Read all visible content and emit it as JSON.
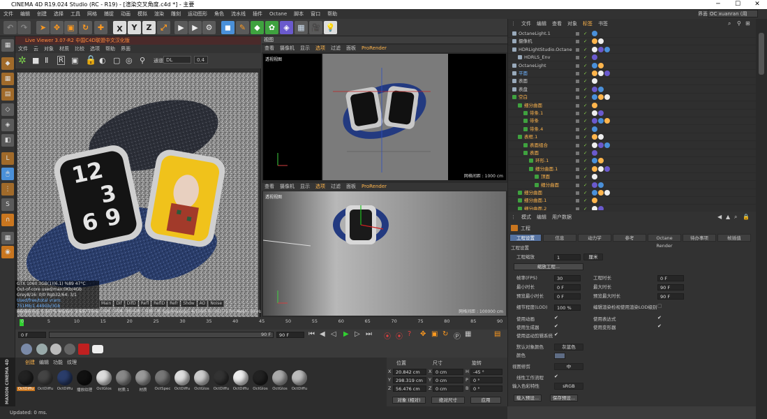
{
  "window": {
    "title": "CINEMA 4D R19.024 Studio (RC - R19) - [渲染交叉角度.c4d *] - 主要",
    "interface_label": "界面:",
    "interface_value": "OC xuanran (用户)"
  },
  "menu": [
    "文件",
    "编辑",
    "创建",
    "选择",
    "工具",
    "网格",
    "捕捉",
    "动画",
    "模拟",
    "渲染",
    "雕刻",
    "运动图形",
    "角色",
    "流水线",
    "插件",
    "Octane",
    "脚本",
    "窗口",
    "帮助"
  ],
  "toolbar": {
    "labels": [
      "X",
      "Y",
      "Z"
    ]
  },
  "live_viewer": {
    "title": "Live Viewer 3.07-R2 中国C4D联盟中文汉化版",
    "menu": [
      "文件",
      "云",
      "对象",
      "材质",
      "比较",
      "选项",
      "帮助",
      "界面"
    ],
    "channel_label": "通道",
    "channel_value": "DL",
    "value_num": "0.4",
    "stats": [
      "GTX 1060 3GB(1)(6.1)   %89   47°C",
      "Out-of-core used/max:0Kb/4Gb",
      "Grey8/16: 0/0          Rgb32/64: 3/1",
      "Used/free/total vram: 751Mb/1.449Gb/3Gb"
    ],
    "tabs": [
      "Main",
      "Dif",
      "DifD",
      "Refl",
      "ReflD",
      "Refr",
      "Shdw",
      "AO",
      "Noise"
    ],
    "render_line": "Rendering: 0.267%  Ms/sec: 3.697   Time: 小时 : 分钟 : 秒/小时 : 分钟 : 秒   Spp/maxspp: 4/1500   Tri: 0/1.727m  Mesh: 29   Hair: 0",
    "watch_numbers": [
      "12",
      "3",
      "6",
      "9"
    ]
  },
  "viewport_top": {
    "title": "视图",
    "menu": [
      "查看",
      "摄像机",
      "显示",
      "选项",
      "过滤",
      "面板",
      "ProRender"
    ],
    "label": "透视视图",
    "grid": "网格间距 : 1000 cm"
  },
  "viewport_bottom": {
    "menu": [
      "查看",
      "摄像机",
      "显示",
      "选项",
      "过滤",
      "面板",
      "ProRender"
    ],
    "label": "透视视图",
    "grid": "网格间距 : 100000 cm"
  },
  "timeline": {
    "ticks": [
      "0",
      "5",
      "10",
      "15",
      "20",
      "25",
      "30",
      "35",
      "40",
      "45",
      "50",
      "55",
      "60",
      "65",
      "70",
      "75",
      "80",
      "85",
      "90"
    ],
    "frame_end": "90 F",
    "start": "0 F",
    "current": "0 F",
    "max1": "90 F",
    "max2": "90 F"
  },
  "materials": {
    "menu": [
      "创建",
      "编辑",
      "功能",
      "纹理"
    ],
    "items": [
      "OctDiffu",
      "OctDiffu",
      "OctDiffu",
      "播放纹理",
      "OctGlos",
      "材质.1",
      "材质",
      "OctSpec",
      "OctDiffu",
      "OctGlos",
      "OctDiffu",
      "OctDiffu",
      "OctGlos",
      "OctGlos",
      "OctDiffu"
    ]
  },
  "coords": {
    "headers": [
      "位置",
      "尺寸",
      "旋转"
    ],
    "rows": [
      {
        "axis": "X",
        "pos": "20.842 cm",
        "size": "0 cm",
        "rlabel": "H",
        "rot": "-45 °"
      },
      {
        "axis": "Y",
        "pos": "298.319 cm",
        "size": "0 cm",
        "rlabel": "P",
        "rot": "0 °"
      },
      {
        "axis": "Z",
        "pos": "56.476 cm",
        "size": "0 cm",
        "rlabel": "B",
        "rot": "0 °"
      }
    ],
    "mode1": "对象 (相对)",
    "mode2": "绝对尺寸",
    "apply": "应用"
  },
  "status": "Updated: 0 ms.",
  "object_manager": {
    "menu": [
      "文件",
      "编辑",
      "查看",
      "对象",
      "标签",
      "书签"
    ],
    "rows": [
      {
        "name": "OctaneLight.1",
        "indent": 0,
        "color": "#c8c8c8"
      },
      {
        "name": "摄像机",
        "indent": 0,
        "color": "#c8c8c8"
      },
      {
        "name": "HDRLightStudio.Octane",
        "indent": 0,
        "color": "#c8c8c8"
      },
      {
        "name": "HDRLS_Env",
        "indent": 1,
        "color": "#c8c8c8"
      },
      {
        "name": "OctaneLight",
        "indent": 0,
        "color": "#c8c8c8"
      },
      {
        "name": "平面",
        "indent": 0,
        "color": "#6fb3ff"
      },
      {
        "name": "表面",
        "indent": 0,
        "color": "#c8c8c8"
      },
      {
        "name": "表盘",
        "indent": 0,
        "color": "#c8c8c8"
      },
      {
        "name": "空白",
        "indent": 0,
        "color": "#ffb54c"
      },
      {
        "name": "细分曲面",
        "indent": 1,
        "color": "#ffb54c"
      },
      {
        "name": "带条.1",
        "indent": 2,
        "color": "#ffb54c"
      },
      {
        "name": "带条",
        "indent": 2,
        "color": "#ffb54c"
      },
      {
        "name": "带条.4",
        "indent": 2,
        "color": "#ffb54c"
      },
      {
        "name": "表框.1",
        "indent": 1,
        "color": "#ffb54c"
      },
      {
        "name": "表面组合",
        "indent": 2,
        "color": "#ffb54c"
      },
      {
        "name": "表面",
        "indent": 2,
        "color": "#ffb54c"
      },
      {
        "name": "环形.1",
        "indent": 3,
        "color": "#ffb54c"
      },
      {
        "name": "细分曲面.1",
        "indent": 3,
        "color": "#ffb54c"
      },
      {
        "name": "顶面",
        "indent": 4,
        "color": "#ffb54c"
      },
      {
        "name": "细分曲面",
        "indent": 4,
        "color": "#ffb54c"
      },
      {
        "name": "细分曲面",
        "indent": 1,
        "color": "#ffb54c"
      },
      {
        "name": "细分曲面.1",
        "indent": 1,
        "color": "#ffb54c"
      },
      {
        "name": "细分曲面.2",
        "indent": 1,
        "color": "#ffb54c"
      }
    ]
  },
  "attributes": {
    "menu": [
      "模式",
      "编辑",
      "用户数据"
    ],
    "header": "工程",
    "tabs": [
      "工程设置",
      "信息",
      "动力学",
      "参考",
      "Octane Render",
      "待办事项",
      "帧插值"
    ],
    "section": "工程设置",
    "scale_label": "工程缩放",
    "scale_value": "1",
    "scale_unit": "厘米",
    "scale_btn": "缩放工程...",
    "fps_label": "帧率(FPS)",
    "fps": "30",
    "proj_len_label": "工程时长",
    "proj_len": "0 F",
    "min_label": "最小时长",
    "min": "0 F",
    "max_label": "最大时长",
    "max": "90 F",
    "pmin_label": "预览最小时长",
    "pmin": "0 F",
    "pmax_label": "预览最大时长",
    "pmax": "90 F",
    "lod_label": "细节程度(LOD)",
    "lod": "100 %",
    "lod2_label": "编辑渲染检视使用渲染LOD级别",
    "anim_label": "使用动画",
    "expr_label": "使用表达式",
    "gen_label": "使用生成器",
    "deform_label": "使用变形器",
    "motion_label": "使用运动剪辑系统",
    "objcolor_label": "默认对象颜色",
    "objcolor": "灰蓝色",
    "color_label": "颜色",
    "clip_label": "视图修剪",
    "clip": "中",
    "linear_label": "线性工作流程",
    "input_label": "输入色彩特性",
    "input": "sRGB",
    "load_btn": "载入预设...",
    "save_btn": "保存预设..."
  }
}
